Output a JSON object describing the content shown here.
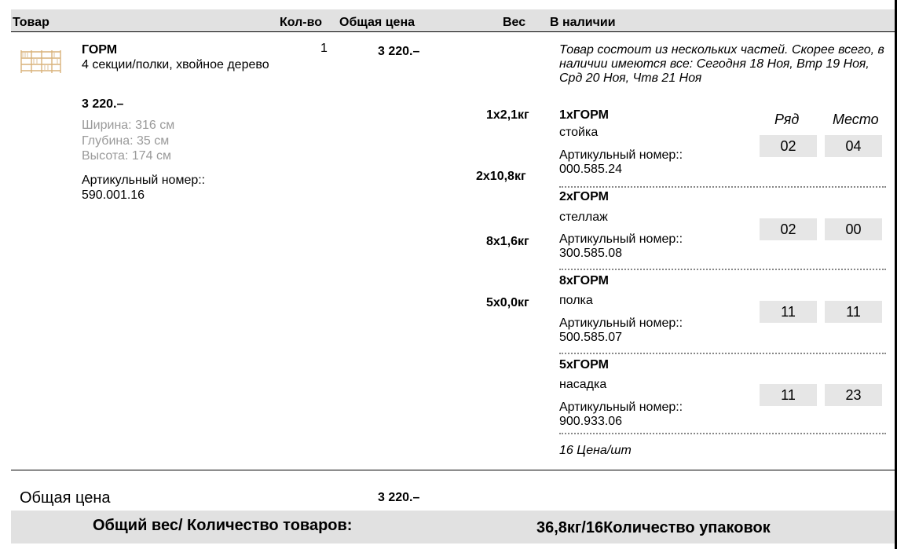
{
  "header": {
    "product": "Товар",
    "qty": "Кол-во",
    "total_price": "Общая цена",
    "weight": "Вес",
    "availability": "В наличии"
  },
  "product": {
    "name": "ГОРМ",
    "description": "4 секции/полки, хвойное дерево",
    "price": "3 220.–",
    "width": "Ширина: 316 см",
    "depth": "Глубина: 35 см",
    "height": "Высота: 174 см",
    "article_label": "Артикульный номер::",
    "article_number": "590.001.16",
    "qty": "1",
    "total": "3 220.–",
    "availability_note": "Товар состоит из нескольких частей. Скорее всего, в наличии имеются все: Сегодня 18 Ноя, Втр 19 Ноя, Срд 20 Ноя, Чтв 21 Ноя"
  },
  "location_headers": {
    "row": "Ряд",
    "place": "Место"
  },
  "parts": [
    {
      "title": "1xГОРМ",
      "type": "стойка",
      "article_label": "Артикульный номер::",
      "article_number": "000.585.24",
      "weight": "1x2,1кг",
      "row": "02",
      "place": "04"
    },
    {
      "title": "2xГОРМ",
      "type": "стеллаж",
      "article_label": "Артикульный номер::",
      "article_number": "300.585.08",
      "weight": "2x10,8кг",
      "row": "02",
      "place": "00"
    },
    {
      "title": "8xГОРМ",
      "type": "полка",
      "article_label": "Артикульный номер::",
      "article_number": "500.585.07",
      "weight": "8x1,6кг",
      "row": "11",
      "place": "11"
    },
    {
      "title": "5xГОРМ",
      "type": "насадка",
      "article_label": "Артикульный номер::",
      "article_number": "900.933.06",
      "weight": "5x0,0кг",
      "row": "11",
      "place": "23"
    }
  ],
  "price_per_unit": "16 Цена/шт",
  "footer": {
    "total_label": "Общая цена",
    "total_value": "3 220.–",
    "weight_label": "Общий вес/ Количество товаров:",
    "weight_value": "36,8кг/16Количество упаковок"
  },
  "colors": {
    "header_bg": "#e1e1e1",
    "cell_bg": "#e6e6e6",
    "muted_text": "#9a9a9a"
  }
}
